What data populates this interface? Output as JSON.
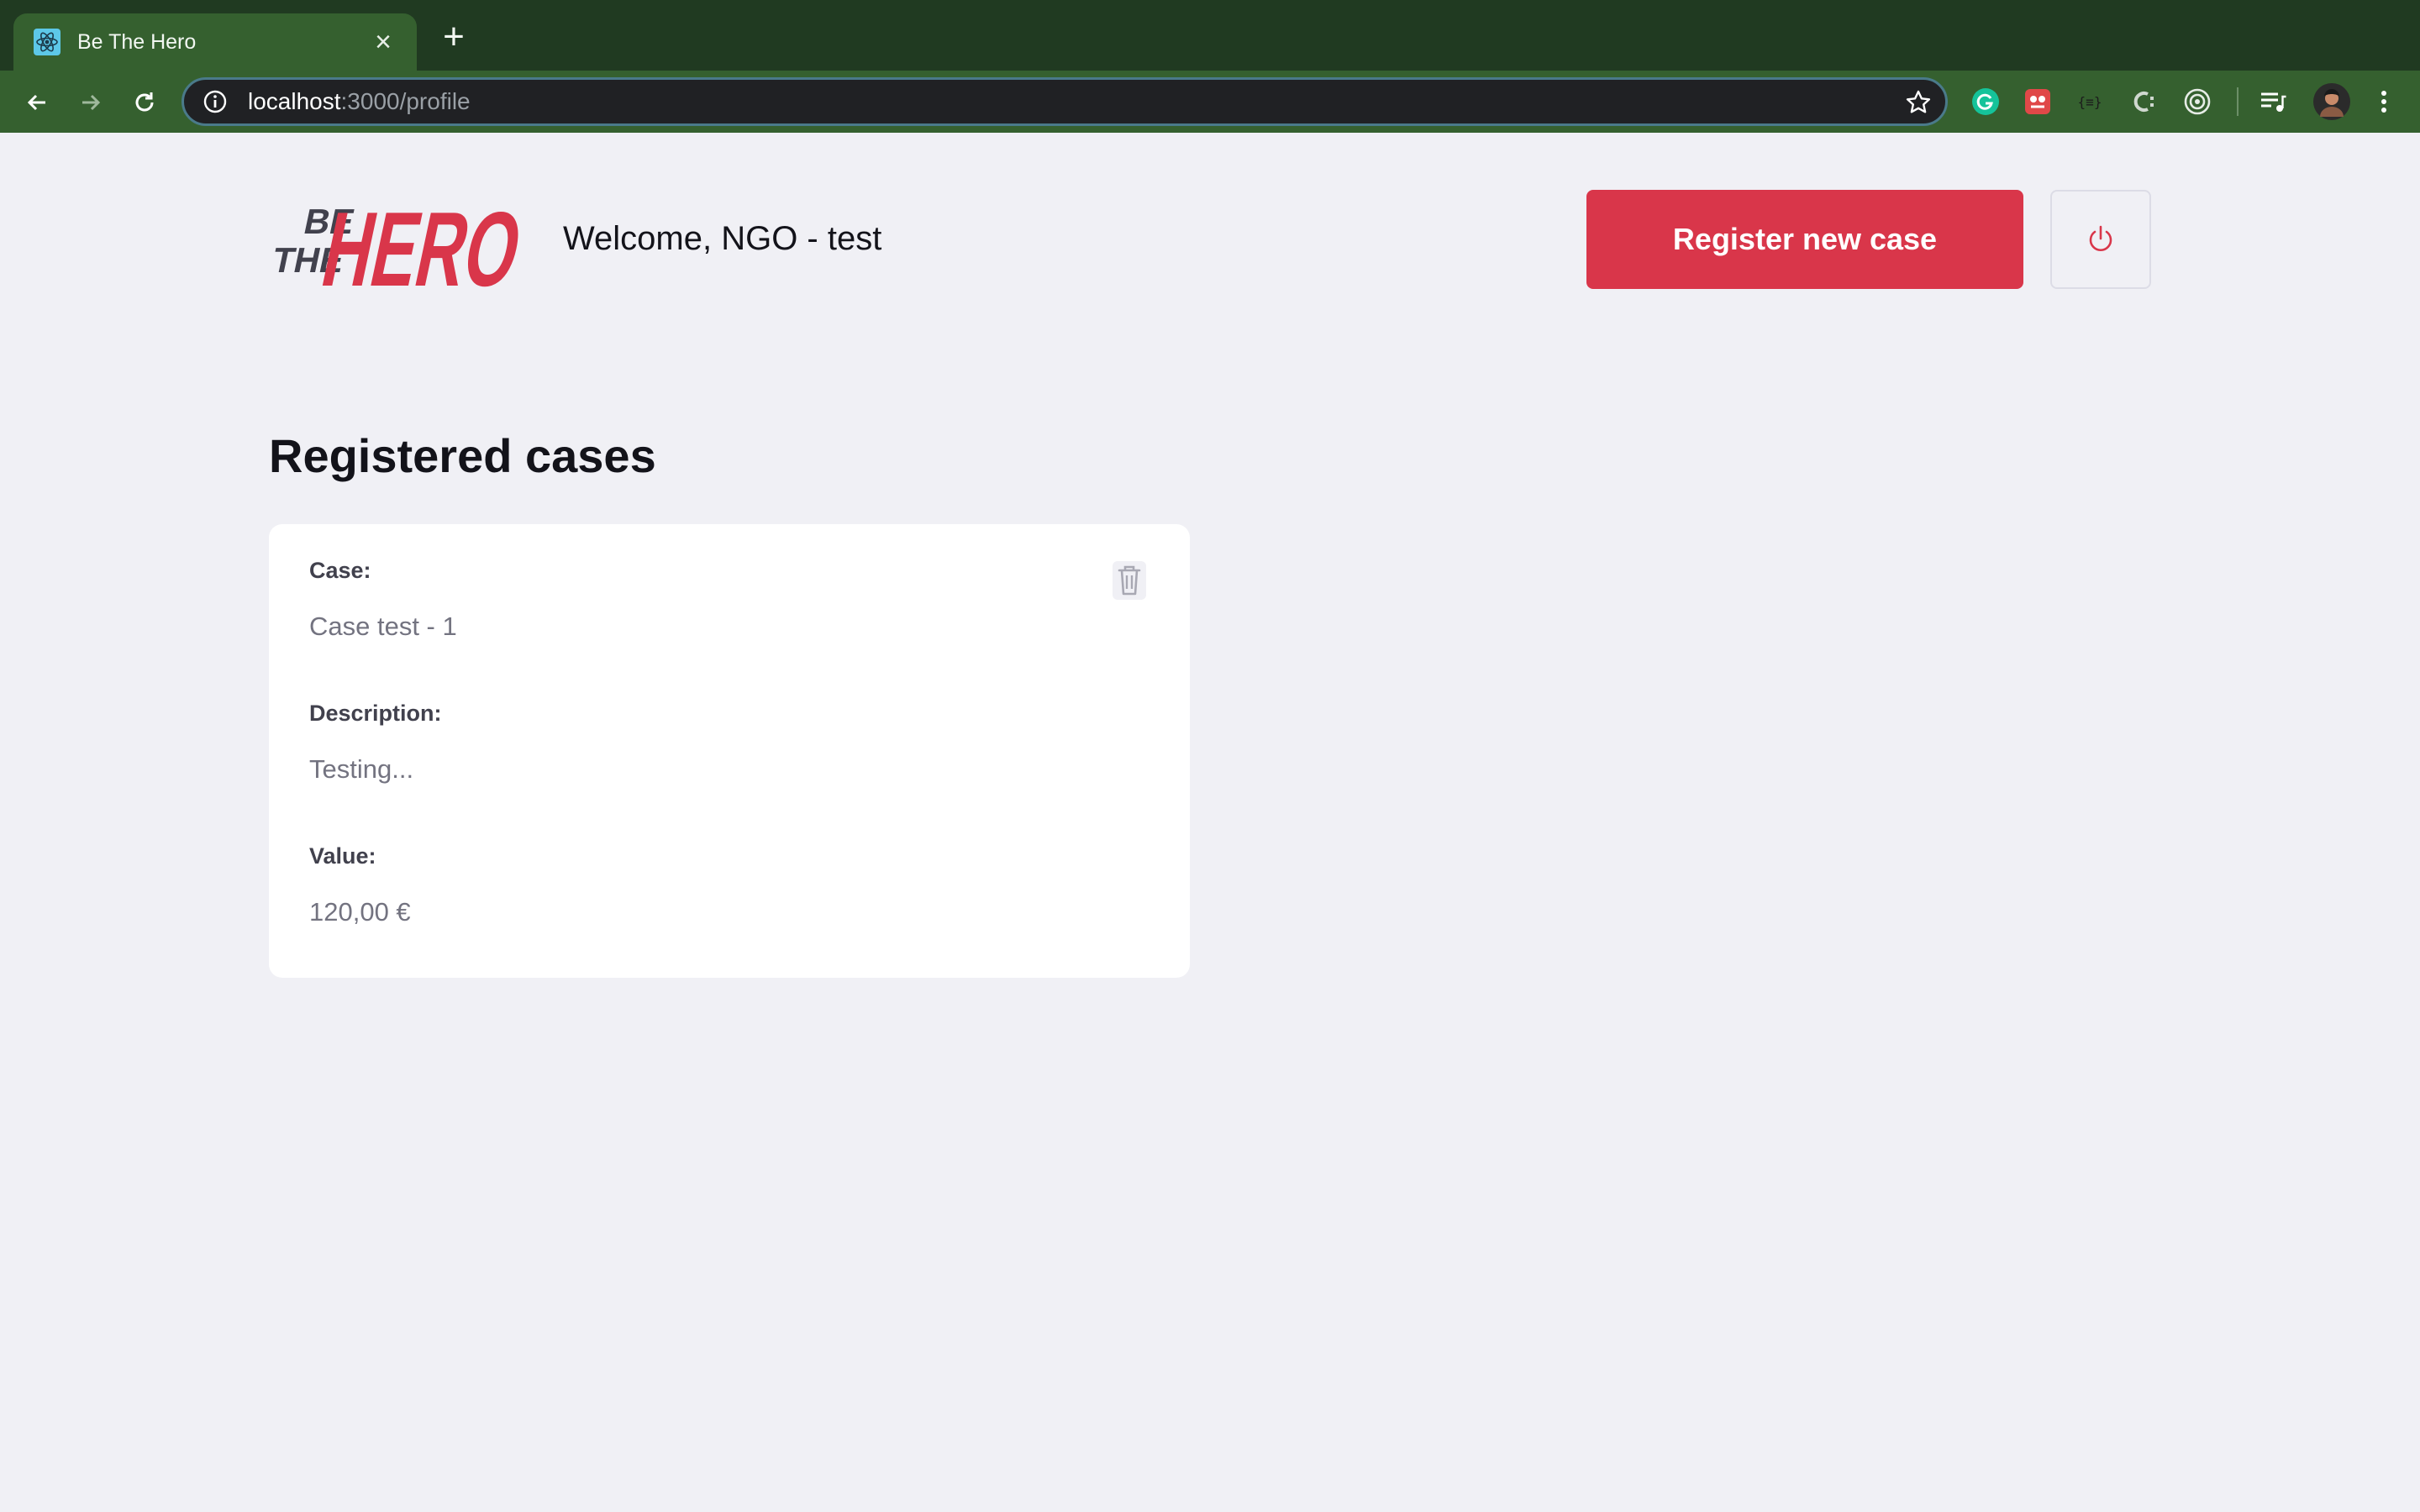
{
  "browser": {
    "tab_title": "Be The Hero",
    "url_host": "localhost",
    "url_path": ":3000/profile"
  },
  "header": {
    "logo_text": "BE THE HERO",
    "welcome": "Welcome, NGO - test",
    "register_label": "Register new case"
  },
  "main": {
    "section_title": "Registered cases",
    "cases": [
      {
        "case_label": "Case:",
        "case_value": "Case test - 1",
        "description_label": "Description:",
        "description_value": "Testing...",
        "value_label": "Value:",
        "value_value": "120,00 €"
      }
    ]
  },
  "colors": {
    "brand": "#d9364a",
    "background": "#f0f0f5",
    "tabstrip": "#203a21",
    "toolbar": "#35602f"
  },
  "icons": [
    "react-favicon",
    "close-icon",
    "plus-icon",
    "back-arrow-icon",
    "forward-arrow-icon",
    "reload-icon",
    "info-icon",
    "star-icon",
    "grammarly-icon",
    "extension-icon",
    "json-icon",
    "css-icon",
    "target-icon",
    "media-playlist-icon",
    "avatar",
    "kebab-menu-icon",
    "power-icon",
    "trash-icon"
  ]
}
